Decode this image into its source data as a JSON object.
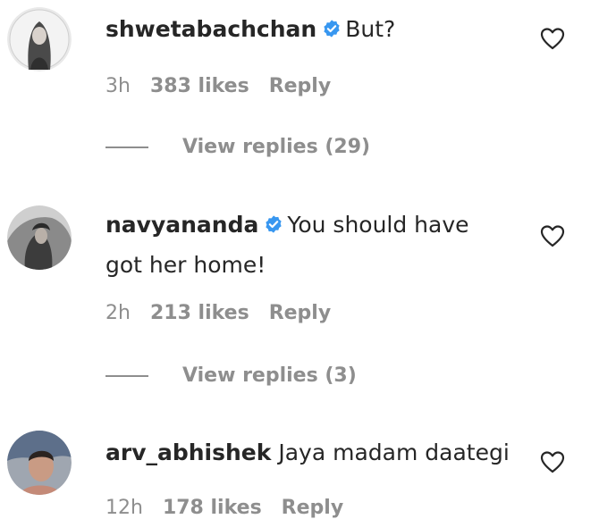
{
  "comments": [
    {
      "username": "shwetabachchan",
      "verified": true,
      "text": "But?",
      "time": "3h",
      "likes": "383 likes",
      "reply": "Reply",
      "view_replies": "View replies (29)"
    },
    {
      "username": "navyananda",
      "verified": true,
      "text_line1": "You should have",
      "text_line2": "got her home!",
      "time": "2h",
      "likes": "213 likes",
      "reply": "Reply",
      "view_replies": "View replies (3)"
    },
    {
      "username": "arv_abhishek",
      "verified": false,
      "text": "Jaya madam daategi",
      "time": "12h",
      "likes": "178 likes",
      "reply": "Reply"
    }
  ],
  "icons": {
    "verified": "verified-badge-icon",
    "like": "heart-icon"
  },
  "colors": {
    "text": "#262626",
    "muted": "#8e8e8e",
    "verified": "#3897f0"
  }
}
